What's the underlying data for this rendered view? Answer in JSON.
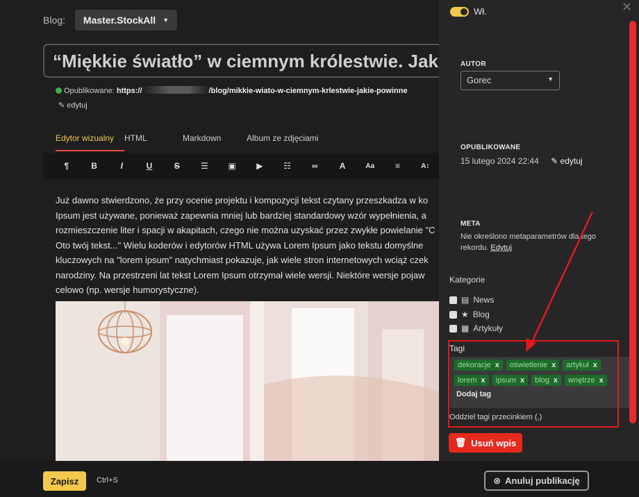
{
  "blog": {
    "label": "Blog:",
    "value": "Master.StockAll"
  },
  "post": {
    "title": "“Miękkie światło” w ciemnym królestwie. Jakie po",
    "published_label": "Opublikowane:",
    "url_start": "https://",
    "url_end": "/blog/mikkie-wiato-w-ciemnym-krlestwie-jakie-powinne",
    "edit": "edytuj"
  },
  "tabs": [
    "Edytor wizualny",
    "HTML",
    "Markdown",
    "Album ze zdjęciami"
  ],
  "toolbar": [
    {
      "icon": "paragraph-icon",
      "glyph": "¶"
    },
    {
      "icon": "bold-icon",
      "glyph": "B"
    },
    {
      "icon": "italic-icon",
      "glyph": "I"
    },
    {
      "icon": "underline-icon",
      "glyph": "U"
    },
    {
      "icon": "strikethrough-icon",
      "glyph": "S"
    },
    {
      "icon": "list-icon",
      "glyph": "☰"
    },
    {
      "icon": "image-icon",
      "glyph": "▣"
    },
    {
      "icon": "video-icon",
      "glyph": "▶"
    },
    {
      "icon": "table-icon",
      "glyph": "☷"
    },
    {
      "icon": "link-icon",
      "glyph": "∞"
    },
    {
      "icon": "text-color-icon",
      "glyph": "A"
    },
    {
      "icon": "font-size-icon",
      "glyph": "Aa"
    },
    {
      "icon": "align-icon",
      "glyph": "≡"
    },
    {
      "icon": "line-height-icon",
      "glyph": "A↕"
    }
  ],
  "body": [
    "Już dawno stwierdzono, że przy ocenie projektu i kompozycji tekst czytany przeszkadza w ko",
    "Ipsum jest używane, ponieważ zapewnia mniej lub bardziej standardowy wzór wypełnienia, a",
    "rozmieszczenie liter i spacji w akapitach, czego nie można uzyskać przez zwykłe powielanie \"C",
    "Oto twój tekst...\" Wielu koderów i edytorów HTML używa Lorem Ipsum jako tekstu domyślne",
    "kluczowych na \"lorem ipsum\" natychmiast pokazuje, jak wiele stron internetowych wciąż czek",
    "narodziny. Na przestrzeni lat tekst Lorem Ipsum otrzymał wiele wersji. Niektóre wersje pojaw",
    "celowo (np. wersje humorystyczne)."
  ],
  "panel": {
    "toggle_label": "Wł.",
    "author_heading": "AUTOR",
    "author_value": "Gorec",
    "published_heading": "OPUBLIKOWANE",
    "published_date": "15 lutego 2024 22:44",
    "published_edit": "edytuj",
    "meta_heading": "META",
    "meta_text": "Nie określono metaparametrów dla tego rekordu.",
    "meta_edit": "Edytuj",
    "categories_heading": "Kategorie",
    "categories": [
      "News",
      "Blog",
      "Artykuły"
    ],
    "tags_heading": "Tagi",
    "tags_row1": [
      "dekoracje",
      "oświetlenie",
      "artykuł"
    ],
    "tags_row2": [
      "lorem",
      "ipsum",
      "blog",
      "wnętrze"
    ],
    "add_tag": "Dodaj tag",
    "tags_hint": "Oddziel tagi przecinkiem (,)",
    "delete": "Usuń wpis"
  },
  "footer": {
    "save": "Zapisz",
    "shortcut": "Ctrl+S",
    "cancel": "Anuluj publikację"
  },
  "colors": {
    "accent": "#f2c94c",
    "danger": "#e5291d",
    "tag_bg": "#1d6b2a"
  }
}
